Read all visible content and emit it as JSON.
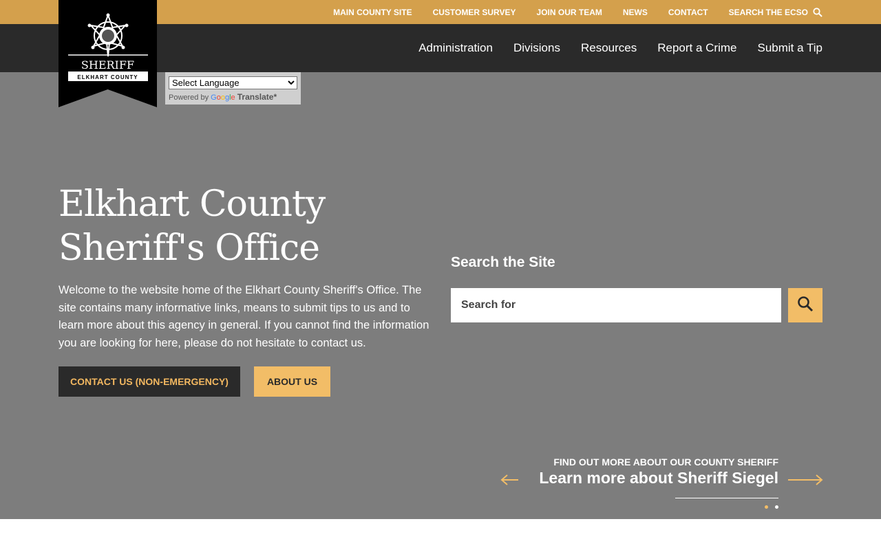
{
  "topbar": {
    "links": [
      "MAIN COUNTY SITE",
      "CUSTOMER SURVEY",
      "JOIN OUR TEAM",
      "NEWS",
      "CONTACT"
    ],
    "search_label": "SEARCH THE ECSO",
    "search_icon": "search-icon"
  },
  "nav": {
    "items": [
      "Administration",
      "Divisions",
      "Resources",
      "Report a Crime",
      "Submit a Tip"
    ]
  },
  "logo": {
    "title": "SHERIFF",
    "subtitle": "ELKHART COUNTY"
  },
  "translate": {
    "select_label": "Select Language",
    "powered_by": "Powered by",
    "google": "Google",
    "translate_text": "Translate"
  },
  "hero": {
    "title_line1": "Elkhart County",
    "title_line2": "Sheriff's Office",
    "description": "Welcome to the website home of the Elkhart County Sheriff's Office. The site contains many informative links, means to submit tips to us and to learn more about this agency in general. If you cannot find the information you are looking for here, please do not hesitate to contact us.",
    "contact_button": "CONTACT US (NON-EMERGENCY)",
    "about_button": "ABOUT US"
  },
  "search": {
    "heading": "Search the Site",
    "placeholder": "Search for"
  },
  "slider": {
    "kicker": "FIND OUT MORE ABOUT OUR COUNTY SHERIFF",
    "title": "Learn more about Sheriff Siegel",
    "active_slide": 1,
    "total_slides": 2
  },
  "colors": {
    "gold": "#d4a04c",
    "light_gold": "#f2bd67",
    "dark": "#2a2a2a",
    "hero_gray": "#7d7d7d"
  }
}
